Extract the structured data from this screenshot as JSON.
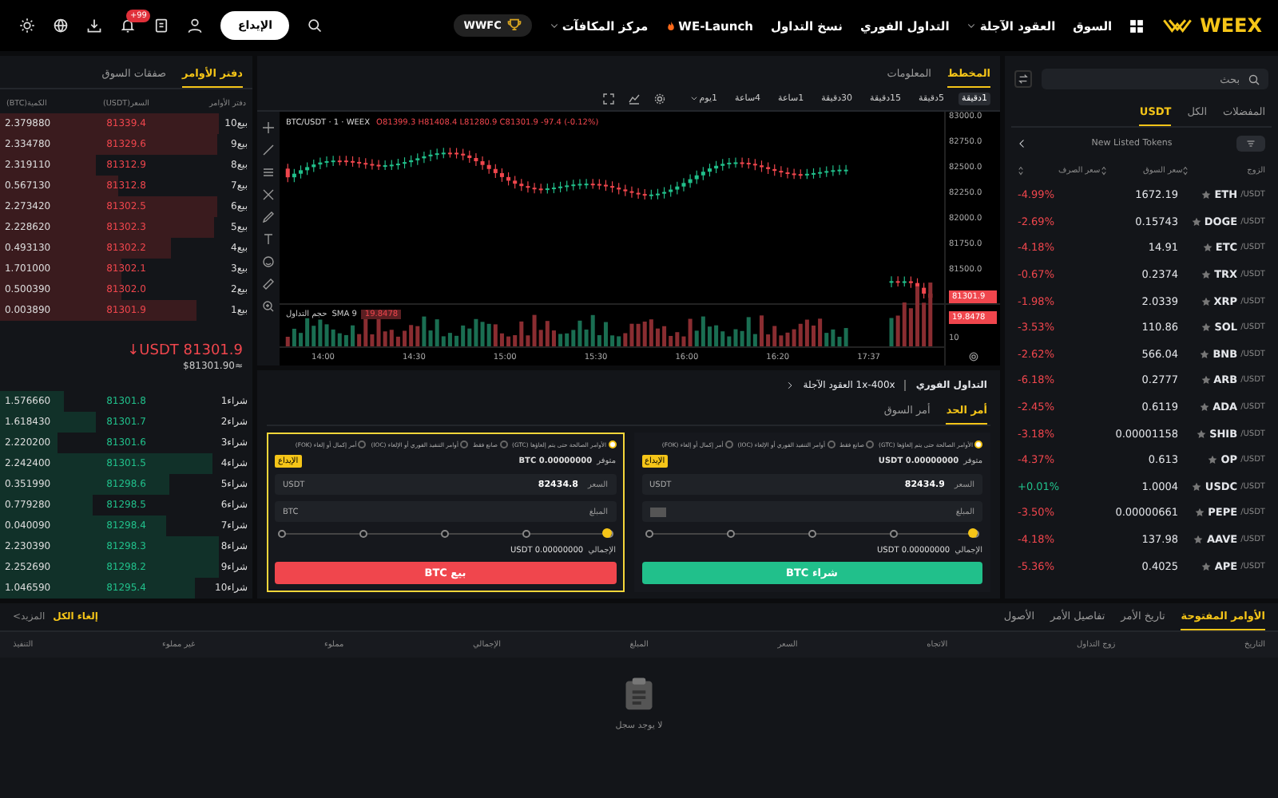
{
  "nav": {
    "logo": "WEEX",
    "items": [
      {
        "label": "السوق",
        "dropdown": false,
        "hot": false
      },
      {
        "label": "العقود الآجلة",
        "dropdown": true,
        "hot": false
      },
      {
        "label": "التداول الفوري",
        "dropdown": false,
        "hot": false
      },
      {
        "label": "نسخ التداول",
        "dropdown": false,
        "hot": false
      },
      {
        "label": "WE-Launch",
        "dropdown": false,
        "hot": true
      },
      {
        "label": "مركز المكافآت",
        "dropdown": true,
        "hot": false
      }
    ],
    "badge": "WWFC",
    "deposit": "الإيداع",
    "notification_count": "+99"
  },
  "market": {
    "search_placeholder": "بحث",
    "tabs": [
      {
        "label": "المفضلات",
        "selected": false
      },
      {
        "label": "الكل",
        "selected": false
      },
      {
        "label": "USDT",
        "selected": true
      }
    ],
    "filter_label": "New Listed Tokens",
    "columns": [
      "الزوج",
      "سعر السوق",
      "سعر الصرف"
    ],
    "rows": [
      {
        "base": "ETH",
        "quote": "/USDT",
        "price": "1672.19",
        "change": "-4.99%",
        "color": "#f0464d"
      },
      {
        "base": "DOGE",
        "quote": "/USDT",
        "price": "0.15743",
        "change": "-2.69%",
        "color": "#f0464d"
      },
      {
        "base": "ETC",
        "quote": "/USDT",
        "price": "14.91",
        "change": "-4.18%",
        "color": "#f0464d"
      },
      {
        "base": "TRX",
        "quote": "/USDT",
        "price": "0.2374",
        "change": "-0.67%",
        "color": "#f0464d"
      },
      {
        "base": "XRP",
        "quote": "/USDT",
        "price": "2.0339",
        "change": "-1.98%",
        "color": "#f0464d"
      },
      {
        "base": "SOL",
        "quote": "/USDT",
        "price": "110.86",
        "change": "-3.53%",
        "color": "#f0464d"
      },
      {
        "base": "BNB",
        "quote": "/USDT",
        "price": "566.04",
        "change": "-2.62%",
        "color": "#f0464d"
      },
      {
        "base": "ARB",
        "quote": "/USDT",
        "price": "0.2777",
        "change": "-6.18%",
        "color": "#f0464d"
      },
      {
        "base": "ADA",
        "quote": "/USDT",
        "price": "0.6119",
        "change": "-2.45%",
        "color": "#f0464d"
      },
      {
        "base": "SHIB",
        "quote": "/USDT",
        "price": "0.00001158",
        "change": "-3.18%",
        "color": "#f0464d"
      },
      {
        "base": "OP",
        "quote": "/USDT",
        "price": "0.613",
        "change": "-4.37%",
        "color": "#f0464d"
      },
      {
        "base": "USDC",
        "quote": "/USDT",
        "price": "1.0004",
        "change": "+0.01%",
        "color": "#21c08b"
      },
      {
        "base": "PEPE",
        "quote": "/USDT",
        "price": "0.00000661",
        "change": "-3.50%",
        "color": "#f0464d"
      },
      {
        "base": "AAVE",
        "quote": "/USDT",
        "price": "137.98",
        "change": "-4.18%",
        "color": "#f0464d"
      },
      {
        "base": "APE",
        "quote": "/USDT",
        "price": "0.4025",
        "change": "-5.36%",
        "color": "#f0464d"
      }
    ]
  },
  "chart_panel": {
    "tabs": [
      {
        "label": "المخطط",
        "selected": true
      },
      {
        "label": "المعلومات",
        "selected": false
      }
    ],
    "intervals": [
      {
        "label": "1دقيقة",
        "selected": true,
        "dropdown": false
      },
      {
        "label": "5دقيقة",
        "selected": false,
        "dropdown": false
      },
      {
        "label": "15دقيقة",
        "selected": false,
        "dropdown": false
      },
      {
        "label": "30دقيقة",
        "selected": false,
        "dropdown": false
      },
      {
        "label": "1ساعة",
        "selected": false,
        "dropdown": false
      },
      {
        "label": "4ساعة",
        "selected": false,
        "dropdown": false
      },
      {
        "label": "1يوم",
        "selected": false,
        "dropdown": true
      }
    ],
    "symbol": "BTC/USDT · 1 · WEEX",
    "ohlc": "O81399.3 H81408.4 L81280.9 C81301.9 -97.4 (-0.12%)",
    "y_ticks": [
      "83000.0",
      "82750.0",
      "82500.0",
      "82250.0",
      "82000.0",
      "81750.0",
      "81500.0"
    ],
    "price_tag": "81301.9",
    "volume_label": "حجم التداول",
    "sma_label": "SMA 9",
    "sma_value": "19.8478",
    "volume_tag": "19.8478",
    "volume_tick": "10",
    "x_ticks": [
      "17:37",
      "16:20",
      "16:00",
      "15:30",
      "15:00",
      "14:30",
      "14:00"
    ]
  },
  "order_panel": {
    "spot_label": "التداول الفوري",
    "futures_label": "1x-400x العقود الآجلة",
    "tabs": [
      {
        "label": "أمر الحد",
        "selected": true
      },
      {
        "label": "أمر السوق",
        "selected": false
      }
    ],
    "forms": [
      {
        "kind": "buy",
        "highlighted": false,
        "options": [
          {
            "label": "الأوامر الصالحة حتى يتم إلغاؤها (GTC)",
            "selected": true
          },
          {
            "label": "صانع فقط",
            "selected": false
          },
          {
            "label": "أوامر التنفيذ الفوري أو الإلغاء (IOC)",
            "selected": false
          },
          {
            "label": "أمر إكمال أو إلغاء (FOK)",
            "selected": false
          }
        ],
        "available_label": "متوفر",
        "available": "USDT 0.00000000",
        "deposit": "الإيداع",
        "price_label": "السعر",
        "price": "82434.9",
        "price_unit": "USDT",
        "amount_label": "المبلغ",
        "level": 0,
        "total_label": "الإجمالي",
        "total": "USDT 0.00000000",
        "button": "شراء BTC"
      },
      {
        "kind": "sell",
        "highlighted": true,
        "options": [
          {
            "label": "الأوامر الصالحة حتى يتم إلغاؤها (GTC)",
            "selected": true
          },
          {
            "label": "صانع فقط",
            "selected": false
          },
          {
            "label": "أوامر التنفيذ الفوري أو الإلغاء (IOC)",
            "selected": false
          },
          {
            "label": "أمر إكمال أو إلغاء (FOK)",
            "selected": false
          }
        ],
        "available_label": "متوفر",
        "available": "BTC 0.00000000",
        "deposit": "الإيداع",
        "price_label": "السعر",
        "price": "82434.8",
        "price_unit": "USDT",
        "amount_label": "المبلغ",
        "amount_unit": "BTC",
        "level": 0,
        "total_label": "الإجمالي",
        "total": "USDT 0.00000000",
        "button": "بيع BTC"
      }
    ]
  },
  "orderbook": {
    "tabs": [
      {
        "label": "دفتر الأوامر",
        "selected": true
      },
      {
        "label": "صفقات السوق",
        "selected": false
      }
    ],
    "columns": [
      "دفتر الأوامر",
      "السعر(USDT)",
      "الكمية(BTC)"
    ],
    "asks": [
      {
        "label": "بيع10",
        "price": "81339.4",
        "qty": "2.379880",
        "level": 0.87
      },
      {
        "label": "بيع9",
        "price": "81329.6",
        "qty": "2.334780",
        "level": 0.86
      },
      {
        "label": "بيع8",
        "price": "81312.9",
        "qty": "2.319110",
        "level": 0.38
      },
      {
        "label": "بيع7",
        "price": "81312.8",
        "qty": "0.567130",
        "level": 0.47
      },
      {
        "label": "بيع6",
        "price": "81302.5",
        "qty": "2.273420",
        "level": 0.86
      },
      {
        "label": "بيع5",
        "price": "81302.3",
        "qty": "2.228620",
        "level": 0.85
      },
      {
        "label": "بيع4",
        "price": "81302.2",
        "qty": "0.493130",
        "level": 0.68
      },
      {
        "label": "بيع3",
        "price": "81302.1",
        "qty": "1.701000",
        "level": 0.48
      },
      {
        "label": "بيع2",
        "price": "81302.0",
        "qty": "0.500390",
        "level": 0.48
      },
      {
        "label": "بيع1",
        "price": "81301.9",
        "qty": "0.003890",
        "level": 0.78
      }
    ],
    "last_price": "↓USDT 81301.9",
    "fiat_price": "$81301.90≈",
    "bids": [
      {
        "label": "شراء1",
        "price": "81301.8",
        "qty": "1.576660",
        "level": 0.25
      },
      {
        "label": "شراء2",
        "price": "81301.7",
        "qty": "1.618430",
        "level": 0.38
      },
      {
        "label": "شراء3",
        "price": "81301.6",
        "qty": "2.220200",
        "level": 0.23
      },
      {
        "label": "شراء4",
        "price": "81301.5",
        "qty": "2.242400",
        "level": 0.84
      },
      {
        "label": "شراء5",
        "price": "81298.6",
        "qty": "0.351990",
        "level": 0.67
      },
      {
        "label": "شراء6",
        "price": "81298.5",
        "qty": "0.779280",
        "level": 0.37
      },
      {
        "label": "شراء7",
        "price": "81298.4",
        "qty": "0.040090",
        "level": 0.66
      },
      {
        "label": "شراء8",
        "price": "81298.3",
        "qty": "2.230390",
        "level": 0.87
      },
      {
        "label": "شراء9",
        "price": "81298.2",
        "qty": "2.252690",
        "level": 0.87
      },
      {
        "label": "شراء10",
        "price": "81295.4",
        "qty": "1.046590",
        "level": 0.77
      }
    ]
  },
  "orders": {
    "tabs": [
      {
        "label": "الأوامر المفتوحة",
        "selected": true
      },
      {
        "label": "تاريخ الأمر",
        "selected": false
      },
      {
        "label": "تفاصيل الأمر",
        "selected": false
      },
      {
        "label": "الأصول",
        "selected": false
      }
    ],
    "cancel_all": "إلغاء الكل",
    "more": "المزيد>",
    "columns": [
      "التاريخ",
      "زوج التداول",
      "الاتجاه",
      "السعر",
      "المبلغ",
      "الإجمالي",
      "مملوء",
      "غير مملوء",
      "التنفيذ"
    ],
    "empty": "لا يوجد سجل"
  }
}
